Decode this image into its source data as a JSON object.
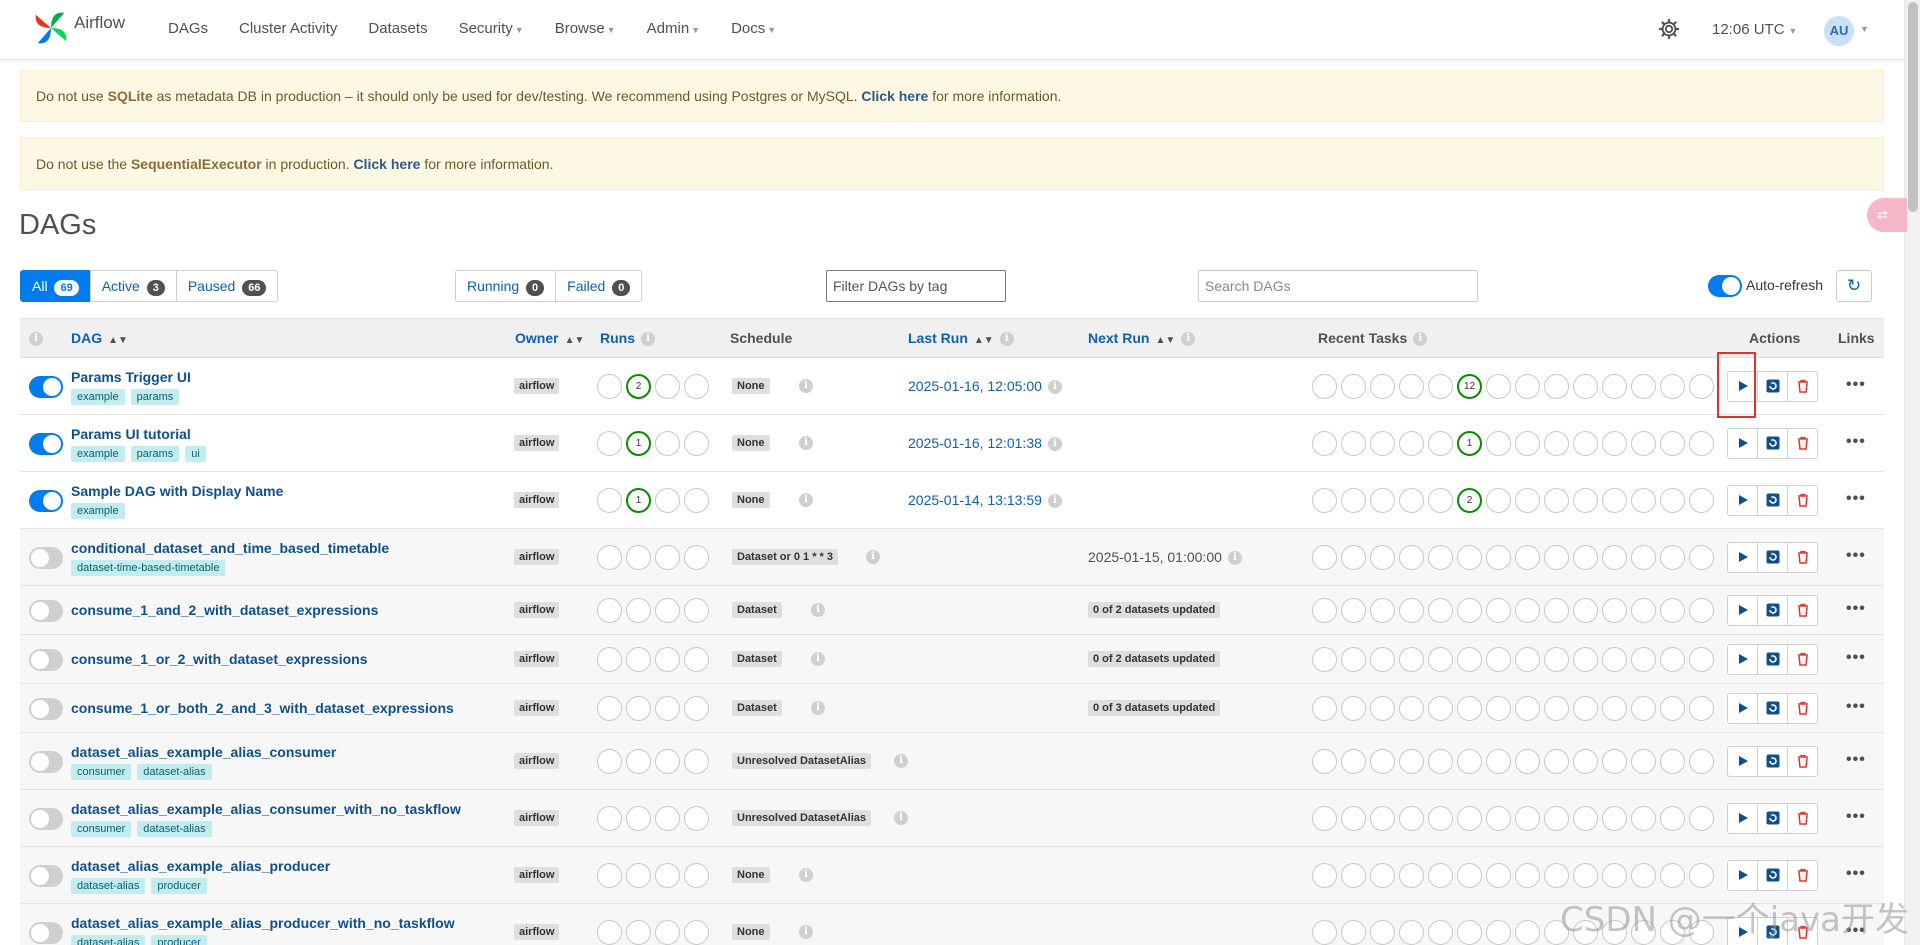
{
  "nav": {
    "brand": "Airflow",
    "items": [
      {
        "label": "DAGs",
        "caret": false
      },
      {
        "label": "Cluster Activity",
        "caret": false
      },
      {
        "label": "Datasets",
        "caret": false
      },
      {
        "label": "Security",
        "caret": true
      },
      {
        "label": "Browse",
        "caret": true
      },
      {
        "label": "Admin",
        "caret": true
      },
      {
        "label": "Docs",
        "caret": true
      }
    ],
    "time": "12:06 UTC",
    "user_initials": "AU"
  },
  "alerts": {
    "sqlite": {
      "pre": "Do not use ",
      "bold": "SQLite",
      "mid": " as metadata DB in production – it should only be used for dev/testing. We recommend using Postgres or MySQL. ",
      "link": "Click here",
      "post": " for more information."
    },
    "executor": {
      "pre": "Do not use the ",
      "bold": "SequentialExecutor",
      "mid": " in production. ",
      "link": "Click here",
      "post": " for more information."
    }
  },
  "page_title": "DAGs",
  "filters": {
    "status": [
      {
        "label": "All",
        "count": "69",
        "active": true
      },
      {
        "label": "Active",
        "count": "3",
        "active": false
      },
      {
        "label": "Paused",
        "count": "66",
        "active": false
      }
    ],
    "run_state": [
      {
        "label": "Running",
        "count": "0"
      },
      {
        "label": "Failed",
        "count": "0"
      }
    ],
    "tag_placeholder": "Filter DAGs by tag",
    "search_placeholder": "Search DAGs",
    "auto_refresh_label": "Auto-refresh"
  },
  "columns": {
    "dag": "DAG",
    "owner": "Owner",
    "runs": "Runs",
    "schedule": "Schedule",
    "last_run": "Last Run",
    "next_run": "Next Run",
    "recent_tasks": "Recent Tasks",
    "actions": "Actions",
    "links": "Links"
  },
  "rows": [
    {
      "name": "Params Trigger UI",
      "tags": [
        "example",
        "params"
      ],
      "active": true,
      "owner": "airflow",
      "run_counts": [
        "",
        "2",
        "",
        ""
      ],
      "schedule": "None",
      "last_run": "2025-01-16, 12:05:00",
      "next_run": "",
      "next_run_badge": "",
      "task_counts": [
        "",
        "",
        "",
        "",
        "",
        "12",
        "",
        "",
        "",
        "",
        "",
        "",
        "",
        ""
      ]
    },
    {
      "name": "Params UI tutorial",
      "tags": [
        "example",
        "params",
        "ui"
      ],
      "active": true,
      "owner": "airflow",
      "run_counts": [
        "",
        "1",
        "",
        ""
      ],
      "schedule": "None",
      "last_run": "2025-01-16, 12:01:38",
      "next_run": "",
      "next_run_badge": "",
      "task_counts": [
        "",
        "",
        "",
        "",
        "",
        "1",
        "",
        "",
        "",
        "",
        "",
        "",
        "",
        ""
      ]
    },
    {
      "name": "Sample DAG with Display Name",
      "tags": [
        "example"
      ],
      "active": true,
      "owner": "airflow",
      "run_counts": [
        "",
        "1",
        "",
        ""
      ],
      "schedule": "None",
      "last_run": "2025-01-14, 13:13:59",
      "next_run": "",
      "next_run_badge": "",
      "task_counts": [
        "",
        "",
        "",
        "",
        "",
        "2",
        "",
        "",
        "",
        "",
        "",
        "",
        "",
        ""
      ]
    },
    {
      "name": "conditional_dataset_and_time_based_timetable",
      "tags": [
        "dataset-time-based-timetable"
      ],
      "active": false,
      "owner": "airflow",
      "run_counts": [
        "",
        "",
        "",
        ""
      ],
      "schedule": "Dataset or 0 1 * * 3",
      "last_run": "",
      "next_run": "2025-01-15, 01:00:00",
      "next_run_badge": "",
      "task_counts": [
        "",
        "",
        "",
        "",
        "",
        "",
        "",
        "",
        "",
        "",
        "",
        "",
        "",
        ""
      ]
    },
    {
      "name": "consume_1_and_2_with_dataset_expressions",
      "tags": [],
      "active": false,
      "owner": "airflow",
      "run_counts": [
        "",
        "",
        "",
        ""
      ],
      "schedule": "Dataset",
      "last_run": "",
      "next_run": "",
      "next_run_badge": "0 of 2 datasets updated",
      "task_counts": [
        "",
        "",
        "",
        "",
        "",
        "",
        "",
        "",
        "",
        "",
        "",
        "",
        "",
        ""
      ]
    },
    {
      "name": "consume_1_or_2_with_dataset_expressions",
      "tags": [],
      "active": false,
      "owner": "airflow",
      "run_counts": [
        "",
        "",
        "",
        ""
      ],
      "schedule": "Dataset",
      "last_run": "",
      "next_run": "",
      "next_run_badge": "0 of 2 datasets updated",
      "task_counts": [
        "",
        "",
        "",
        "",
        "",
        "",
        "",
        "",
        "",
        "",
        "",
        "",
        "",
        ""
      ]
    },
    {
      "name": "consume_1_or_both_2_and_3_with_dataset_expressions",
      "tags": [],
      "active": false,
      "owner": "airflow",
      "run_counts": [
        "",
        "",
        "",
        ""
      ],
      "schedule": "Dataset",
      "last_run": "",
      "next_run": "",
      "next_run_badge": "0 of 3 datasets updated",
      "task_counts": [
        "",
        "",
        "",
        "",
        "",
        "",
        "",
        "",
        "",
        "",
        "",
        "",
        "",
        ""
      ]
    },
    {
      "name": "dataset_alias_example_alias_consumer",
      "tags": [
        "consumer",
        "dataset-alias"
      ],
      "active": false,
      "owner": "airflow",
      "run_counts": [
        "",
        "",
        "",
        ""
      ],
      "schedule": "Unresolved DatasetAlias",
      "last_run": "",
      "next_run": "",
      "next_run_badge": "",
      "task_counts": [
        "",
        "",
        "",
        "",
        "",
        "",
        "",
        "",
        "",
        "",
        "",
        "",
        "",
        ""
      ]
    },
    {
      "name": "dataset_alias_example_alias_consumer_with_no_taskflow",
      "tags": [
        "consumer",
        "dataset-alias"
      ],
      "active": false,
      "owner": "airflow",
      "run_counts": [
        "",
        "",
        "",
        ""
      ],
      "schedule": "Unresolved DatasetAlias",
      "last_run": "",
      "next_run": "",
      "next_run_badge": "",
      "task_counts": [
        "",
        "",
        "",
        "",
        "",
        "",
        "",
        "",
        "",
        "",
        "",
        "",
        "",
        ""
      ]
    },
    {
      "name": "dataset_alias_example_alias_producer",
      "tags": [
        "dataset-alias",
        "producer"
      ],
      "active": false,
      "owner": "airflow",
      "run_counts": [
        "",
        "",
        "",
        ""
      ],
      "schedule": "None",
      "last_run": "",
      "next_run": "",
      "next_run_badge": "",
      "task_counts": [
        "",
        "",
        "",
        "",
        "",
        "",
        "",
        "",
        "",
        "",
        "",
        "",
        "",
        ""
      ]
    },
    {
      "name": "dataset_alias_example_alias_producer_with_no_taskflow",
      "tags": [
        "dataset-alias",
        "producer"
      ],
      "active": false,
      "owner": "airflow",
      "run_counts": [
        "",
        "",
        "",
        ""
      ],
      "schedule": "None",
      "last_run": "",
      "next_run": "",
      "next_run_badge": "",
      "task_counts": [
        "",
        "",
        "",
        "",
        "",
        "",
        "",
        "",
        "",
        "",
        "",
        "",
        "",
        ""
      ]
    }
  ],
  "watermark": "CSDN @一个java开发",
  "colors": {
    "accent": "#017cee",
    "success": "#0a8a00",
    "link": "#0f5faf",
    "delete": "#e53030",
    "tag_bg": "#c1ecf0",
    "alert_bg": "#fcf8e3"
  }
}
